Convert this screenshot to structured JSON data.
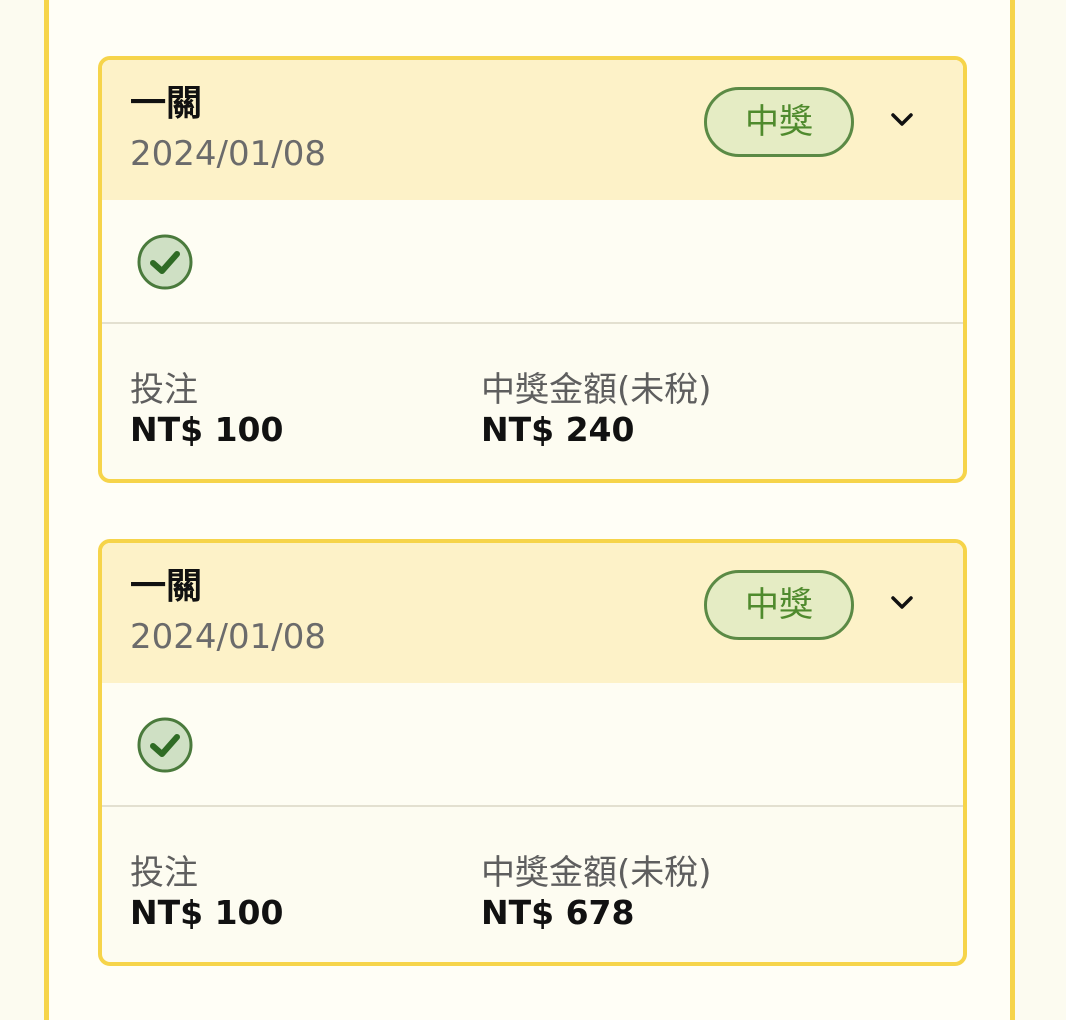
{
  "colors": {
    "border_yellow": "#f6d44a",
    "header_bg": "#fdf2c8",
    "badge_green": "#4f8a2d",
    "badge_bg": "#e5ecc4"
  },
  "cards": [
    {
      "game_name": "一關",
      "date": "2024/01/08",
      "status_badge": "中獎",
      "status_icon": "check-circle-icon",
      "expand_icon": "chevron-down-icon",
      "bet_label": "投注",
      "bet_value": "NT$ 100",
      "prize_label": "中獎金額(未稅)",
      "prize_value": "NT$ 240"
    },
    {
      "game_name": "一關",
      "date": "2024/01/08",
      "status_badge": "中獎",
      "status_icon": "check-circle-icon",
      "expand_icon": "chevron-down-icon",
      "bet_label": "投注",
      "bet_value": "NT$ 100",
      "prize_label": "中獎金額(未稅)",
      "prize_value": "NT$ 678"
    }
  ]
}
